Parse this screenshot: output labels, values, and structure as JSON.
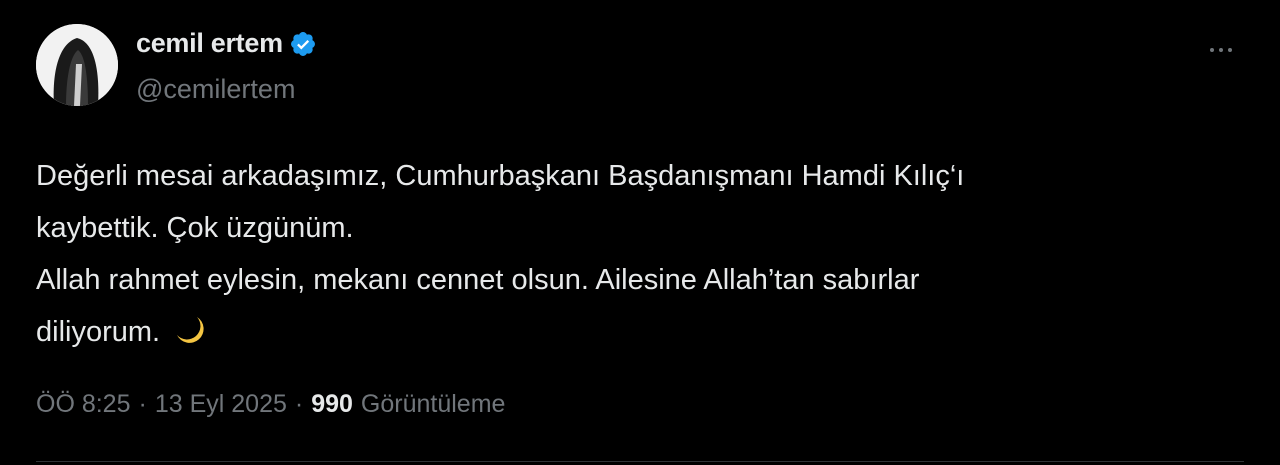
{
  "author": {
    "display_name": "cemil ertem",
    "handle": "@cemilertem",
    "verified": true,
    "verified_color": "#1d9bf0"
  },
  "more_icon": "more-horizontal-icon",
  "tweet": {
    "lines": [
      "Değerli mesai arkadaşımız, Cumhurbaşkanı Başdanışmanı Hamdi Kılıç‘ı",
      "kaybettik. Çok üzgünüm.",
      "Allah rahmet eylesin, mekanı cennet olsun. Ailesine Allah’tan sabırlar",
      "diliyorum."
    ],
    "emoji": "crescent-moon-icon"
  },
  "meta": {
    "time": "ÖÖ 8:25",
    "separator": "·",
    "date": "13 Eyl 2025",
    "views_count": "990",
    "views_label": "Görüntüleme"
  }
}
